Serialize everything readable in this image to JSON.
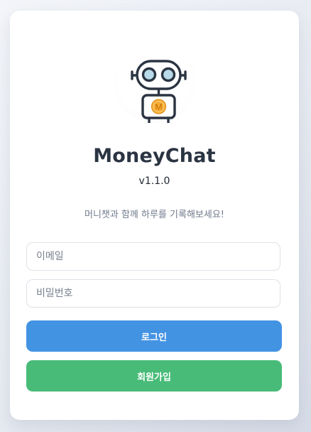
{
  "app": {
    "name": "MoneyChat",
    "version": "v1.1.0",
    "tagline": "머니챗과 함께 하루를 기록해보세요!",
    "logo_icon": "robot-icon",
    "logo_badge_letter": "M"
  },
  "form": {
    "email_placeholder": "이메일",
    "email_value": "",
    "password_placeholder": "비밀번호",
    "password_value": ""
  },
  "buttons": {
    "login_label": "로그인",
    "signup_label": "회원가입"
  },
  "colors": {
    "login_button": "#4393e3",
    "signup_button": "#48bb78",
    "robot_outline": "#2b3442",
    "robot_eye": "#b9dbe9",
    "robot_badge": "#f6ad37"
  }
}
